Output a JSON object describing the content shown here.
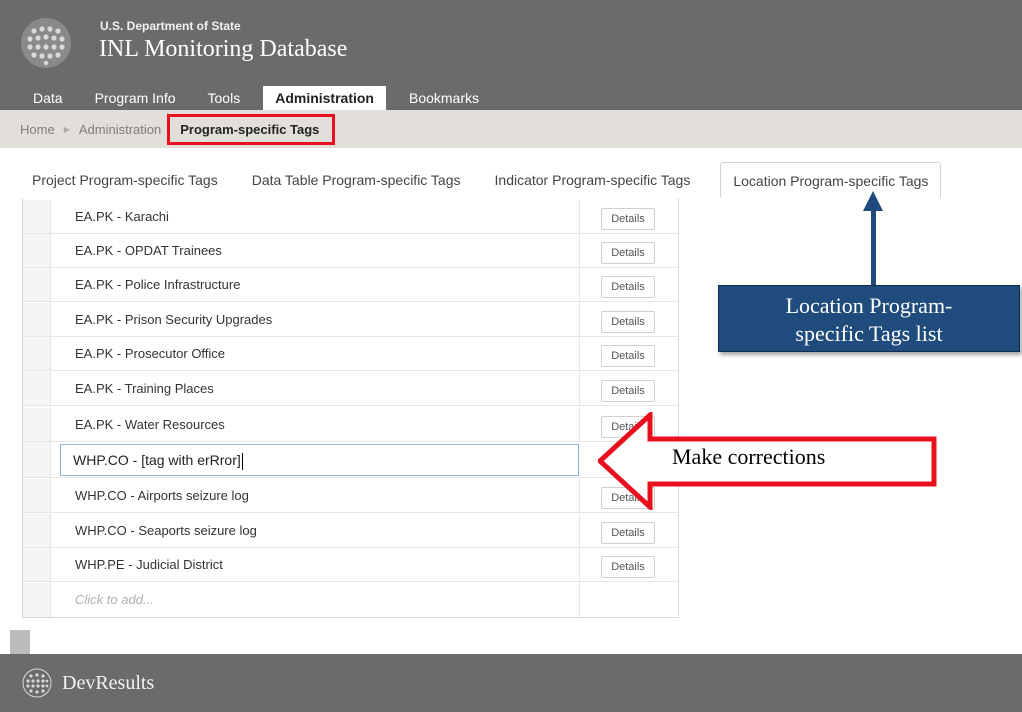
{
  "header": {
    "org": "U.S. Department of State",
    "app_name": "INL Monitoring Database"
  },
  "nav": {
    "items": [
      {
        "label": "Data"
      },
      {
        "label": "Program Info"
      },
      {
        "label": "Tools"
      },
      {
        "label": "Administration",
        "active": true
      },
      {
        "label": "Bookmarks"
      }
    ]
  },
  "breadcrumb": {
    "home": "Home",
    "section": "Administration",
    "current": "Program-specific Tags"
  },
  "tabs": [
    {
      "label": "Project Program-specific Tags"
    },
    {
      "label": "Data Table Program-specific Tags"
    },
    {
      "label": "Indicator Program-specific Tags"
    },
    {
      "label": "Location Program-specific Tags",
      "active": true
    }
  ],
  "table": {
    "rows": [
      {
        "name": "EA.PK - Karachi",
        "action": "Details"
      },
      {
        "name": "EA.PK - OPDAT Trainees",
        "action": "Details"
      },
      {
        "name": "EA.PK - Police Infrastructure",
        "action": "Details"
      },
      {
        "name": "EA.PK - Prison Security Upgrades",
        "action": "Details"
      },
      {
        "name": "EA.PK - Prosecutor Office",
        "action": "Details"
      },
      {
        "name": "EA.PK - Training Places",
        "action": "Details"
      },
      {
        "name": "EA.PK - Water Resources",
        "action": "Details"
      }
    ],
    "editing_value": "WHP.CO - [tag with erRror]",
    "rows_after": [
      {
        "name": "WHP.CO - Airports seizure log",
        "action": "Details"
      },
      {
        "name": "WHP.CO - Seaports seizure log",
        "action": "Details"
      },
      {
        "name": "WHP.PE - Judicial District",
        "action": "Details"
      }
    ],
    "add_placeholder": "Click to add..."
  },
  "annotations": {
    "list_callout_line1": "Location Program-",
    "list_callout_line2": "specific Tags list",
    "corrections_label": "Make corrections",
    "callout_color": "#1f4c7c",
    "highlight_color": "#e8101e"
  },
  "footer": {
    "brand": "DevResults"
  }
}
